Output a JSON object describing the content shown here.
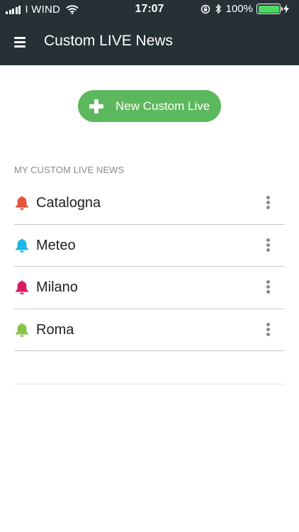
{
  "status_bar": {
    "carrier": "I WIND",
    "time": "17:07",
    "battery": "100%",
    "battery_level": 1.0,
    "battery_color": "#4cd964"
  },
  "header": {
    "title": "Custom LIVE News",
    "background": "#263035"
  },
  "new_button": {
    "label": "New Custom Live",
    "color": "#5cb85c",
    "icon": "plus-icon"
  },
  "section": {
    "heading": "MY CUSTOM LIVE NEWS"
  },
  "items": [
    {
      "label": "Catalogna",
      "bell_color": "#e5533d",
      "icon": "bell-icon"
    },
    {
      "label": "Meteo",
      "bell_color": "#1fb6e8",
      "icon": "bell-icon"
    },
    {
      "label": "Milano",
      "bell_color": "#d81b60",
      "icon": "bell-icon"
    },
    {
      "label": "Roma",
      "bell_color": "#8bc34a",
      "icon": "bell-icon"
    }
  ]
}
